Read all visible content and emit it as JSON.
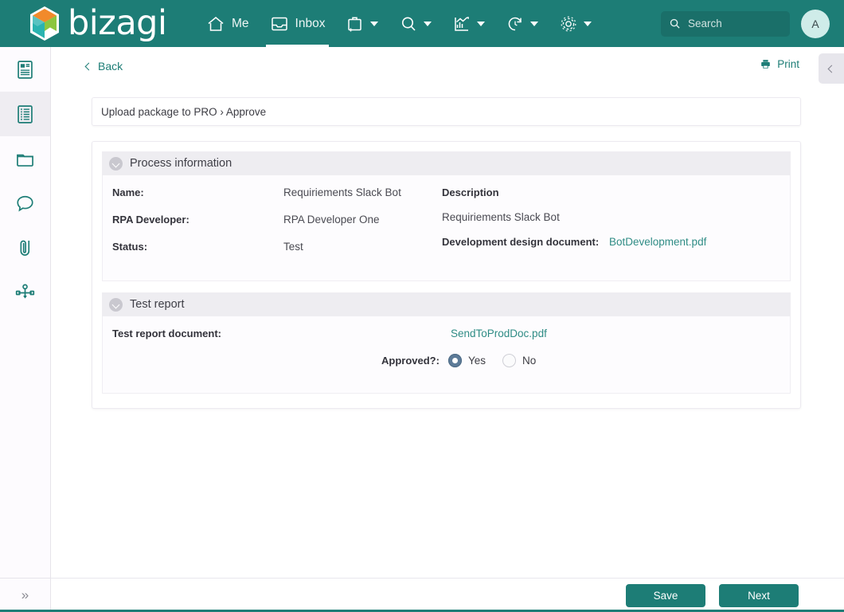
{
  "brand": {
    "name": "bizagi"
  },
  "header": {
    "nav": [
      {
        "id": "me",
        "label": "Me",
        "icon": "home-icon",
        "active": false,
        "caret": false
      },
      {
        "id": "inbox",
        "label": "Inbox",
        "icon": "inbox-tray-icon",
        "active": true,
        "caret": false
      },
      {
        "id": "new-case",
        "label": "",
        "icon": "briefcase-plus-icon",
        "active": false,
        "caret": true
      },
      {
        "id": "search-nav",
        "label": "",
        "icon": "magnifier-icon",
        "active": false,
        "caret": true
      },
      {
        "id": "analytics",
        "label": "",
        "icon": "chart-trend-icon",
        "active": false,
        "caret": true
      },
      {
        "id": "recent",
        "label": "",
        "icon": "refresh-clock-icon",
        "active": false,
        "caret": true
      },
      {
        "id": "settings",
        "label": "",
        "icon": "gear-icon",
        "active": false,
        "caret": true
      }
    ],
    "search": {
      "value": "",
      "placeholder": "Search"
    },
    "avatar": {
      "initial": "A"
    }
  },
  "sidebar": {
    "items": [
      {
        "id": "news",
        "icon": "document-news-icon",
        "active": false
      },
      {
        "id": "forms",
        "icon": "form-list-icon",
        "active": true
      },
      {
        "id": "folders",
        "icon": "folder-icon",
        "active": false
      },
      {
        "id": "comments",
        "icon": "comment-bubble-icon",
        "active": false
      },
      {
        "id": "attachments",
        "icon": "paperclip-icon",
        "active": false
      },
      {
        "id": "process-diagram",
        "icon": "process-flow-icon",
        "active": false
      }
    ],
    "expand_label": "»"
  },
  "toolbar": {
    "back_label": "Back",
    "print_label": "Print",
    "collapse_icon": "chevron-left-icon"
  },
  "breadcrumb": {
    "text": "Upload package to PRO › Approve"
  },
  "sections": {
    "process_information": {
      "title": "Process information",
      "left_fields": [
        {
          "label": "Name:",
          "value": "Requiriements Slack Bot"
        },
        {
          "label": "RPA Developer:",
          "value": "RPA Developer One"
        },
        {
          "label": "Status:",
          "value": "Test"
        }
      ],
      "description_label": "Description",
      "description_value": "Requiriements Slack Bot",
      "design_doc_label": "Development design document:",
      "design_doc_link": "BotDevelopment.pdf"
    },
    "test_report": {
      "title": "Test report",
      "doc_label": "Test report document:",
      "doc_link": "SendToProdDoc.pdf",
      "approved_label": "Approved?:",
      "options": [
        {
          "label": "Yes",
          "selected": true
        },
        {
          "label": "No",
          "selected": false
        }
      ]
    }
  },
  "footer": {
    "save_label": "Save",
    "next_label": "Next"
  },
  "colors": {
    "brand_teal": "#1d7d76",
    "link_teal": "#2f8c85",
    "section_header": "#eeedf1",
    "radio_selected": "#5d7b98",
    "avatar_bg": "#cfece9"
  }
}
